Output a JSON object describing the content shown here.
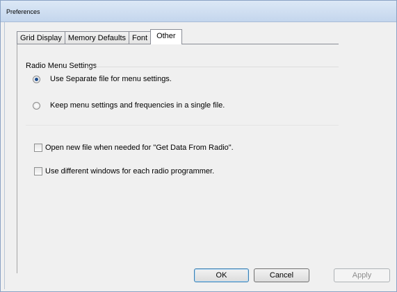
{
  "window": {
    "title": "Preferences"
  },
  "tabs": [
    {
      "label": "Grid Display",
      "active": false
    },
    {
      "label": "Memory Defaults",
      "active": false
    },
    {
      "label": "Font",
      "active": false
    },
    {
      "label": "Other",
      "active": true
    }
  ],
  "radio_group": {
    "title": "Radio Menu Settings",
    "options": [
      {
        "label": "Use Separate file for menu settings.",
        "checked": true
      },
      {
        "label": "Keep menu settings and frequencies in a single file.",
        "checked": false
      }
    ]
  },
  "checkboxes": [
    {
      "label": "Open new file when needed for \"Get Data From Radio\".",
      "checked": false
    },
    {
      "label": "Use different windows for each radio programmer.",
      "checked": false
    }
  ],
  "buttons": {
    "ok": "OK",
    "cancel": "Cancel",
    "apply": "Apply"
  },
  "colors": {
    "accent": "#1f4f8f",
    "disabled_text": "#8d8d8d"
  }
}
